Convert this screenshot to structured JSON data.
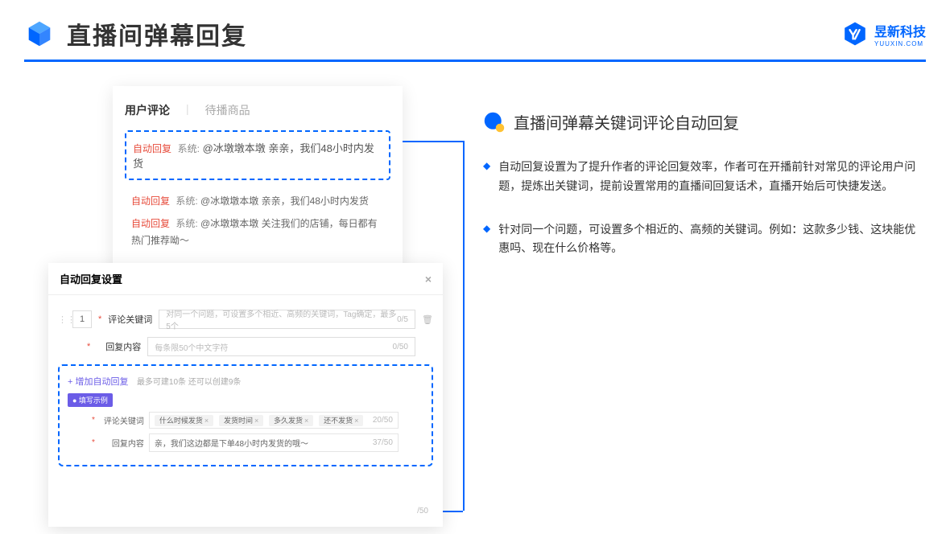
{
  "header": {
    "title": "直播间弹幕回复",
    "brand_name": "昱新科技",
    "brand_sub": "YUUXIN.COM"
  },
  "comments_panel": {
    "tab_active": "用户评论",
    "tab_inactive": "待播商品",
    "highlighted": {
      "tag": "自动回复",
      "sys": "系统:",
      "text": "@冰墩墩本墩 亲亲，我们48小时内发货"
    },
    "items": [
      {
        "tag": "自动回复",
        "sys": "系统:",
        "text": "@冰墩墩本墩 亲亲，我们48小时内发货"
      },
      {
        "tag": "自动回复",
        "sys": "系统:",
        "text": "@冰墩墩本墩 关注我们的店铺，每日都有热门推荐呦～"
      }
    ]
  },
  "settings_panel": {
    "title": "自动回复设置",
    "close": "×",
    "index": "1",
    "row1": {
      "label": "评论关键词",
      "placeholder": "对同一个问题，可设置多个相近、高频的关键词，Tag确定，最多5个",
      "counter": "0/5"
    },
    "row2": {
      "label": "回复内容",
      "placeholder": "每条限50个中文字符",
      "counter": "0/50"
    },
    "add_link": "+ 增加自动回复",
    "add_hint": "最多可建10条 还可以创建9条",
    "example_badge": "● 填写示例",
    "example_row1": {
      "label": "评论关键词",
      "tags": [
        "什么时候发货",
        "发货时间",
        "多久发货",
        "还不发货"
      ],
      "counter": "20/50"
    },
    "example_row2": {
      "label": "回复内容",
      "text": "亲，我们这边都是下单48小时内发货的哦～",
      "counter": "37/50"
    },
    "overflow_counter": "/50"
  },
  "right_section": {
    "title": "直播间弹幕关键词评论自动回复",
    "bullets": [
      "自动回复设置为了提升作者的评论回复效率，作者可在开播前针对常见的评论用户问题，提炼出关键词，提前设置常用的直播间回复话术，直播开始后可快捷发送。",
      "针对同一个问题，可设置多个相近的、高频的关键词。例如：这款多少钱、这块能优惠吗、现在什么价格等。"
    ]
  }
}
